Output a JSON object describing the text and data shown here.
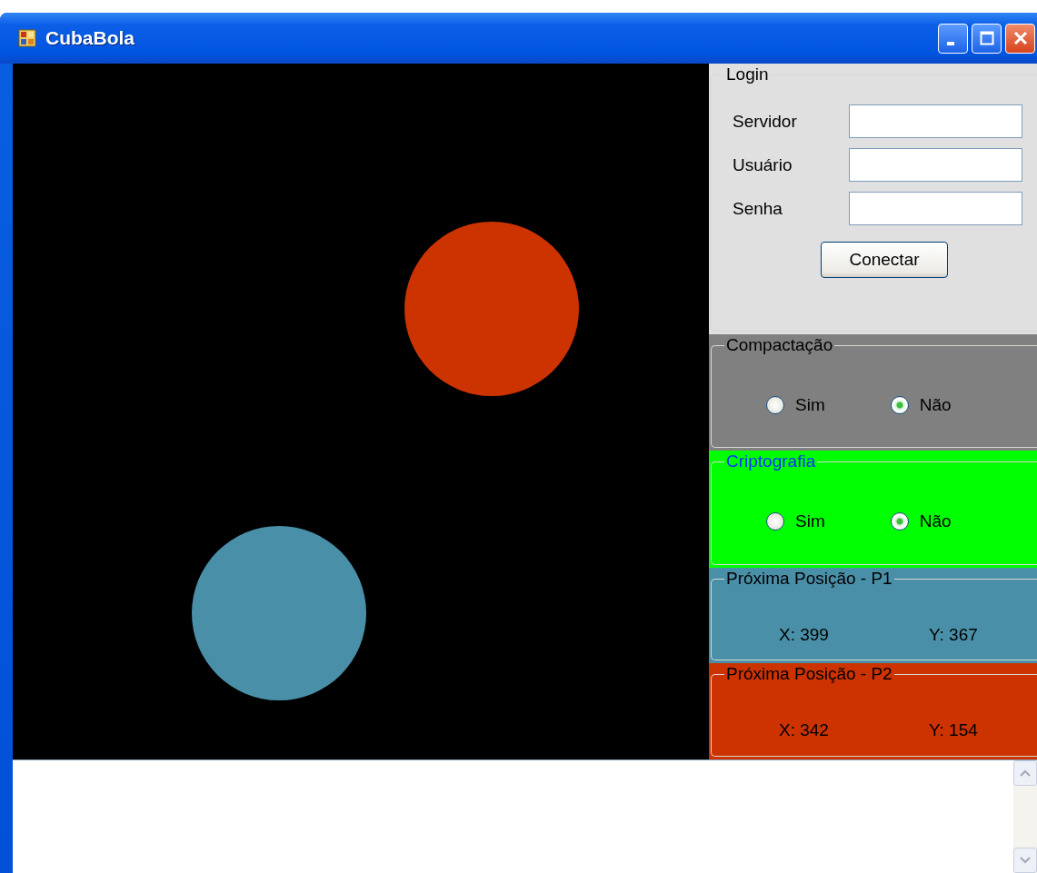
{
  "window": {
    "title": "CubaBola"
  },
  "canvas": {
    "balls": [
      {
        "color": "#cc3300"
      },
      {
        "color": "#4a8fa8"
      }
    ]
  },
  "login": {
    "title": "Login",
    "fields": [
      {
        "label": "Servidor"
      },
      {
        "label": "Usuário"
      },
      {
        "label": "Senha"
      }
    ],
    "button": "Conectar"
  },
  "option_groups": [
    {
      "title": "Compactação",
      "color": "#808080",
      "highlighted": false,
      "options": [
        {
          "label": "Sim",
          "selected": false
        },
        {
          "label": "Não",
          "selected": true
        }
      ]
    },
    {
      "title": "Criptografia",
      "color": "#00ff00",
      "highlighted": true,
      "options": [
        {
          "label": "Sim",
          "selected": false
        },
        {
          "label": "Não",
          "selected": true
        }
      ]
    }
  ],
  "position_groups": [
    {
      "title": "Próxima Posição - P1",
      "color": "#4a8fa8",
      "x": "X: 399",
      "y": "Y: 367"
    },
    {
      "title": "Próxima Posição - P2",
      "color": "#cc3300",
      "x": "X: 342",
      "y": "Y: 154"
    }
  ]
}
